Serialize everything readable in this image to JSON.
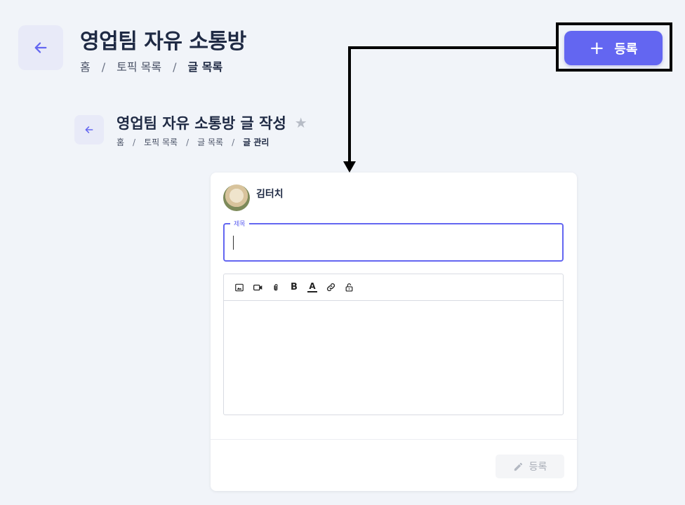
{
  "header": {
    "title": "영업팀 자유 소통방",
    "breadcrumb": [
      "홈",
      "토픽 목록",
      "글 목록"
    ],
    "separator": "/",
    "register_icon": "plus-icon",
    "register_label": "등록"
  },
  "subheader": {
    "title": "영업팀 자유 소통방 글 작성",
    "star": "★",
    "breadcrumb": [
      "홈",
      "토픽 목록",
      "글 목록",
      "글 관리"
    ],
    "separator": "/"
  },
  "form": {
    "author": "김터치",
    "title_label": "제목",
    "title_value": "",
    "toolbar": [
      "image-icon",
      "video-icon",
      "attachment-icon",
      "bold-icon",
      "text-color-icon",
      "link-icon",
      "lock-icon"
    ],
    "bold_glyph": "B",
    "text_color_glyph": "A",
    "submit_label": "등록",
    "submit_icon": "pencil-icon"
  },
  "colors": {
    "accent": "#6366f1",
    "background": "#f1f4f9",
    "annotation": "#000000"
  }
}
